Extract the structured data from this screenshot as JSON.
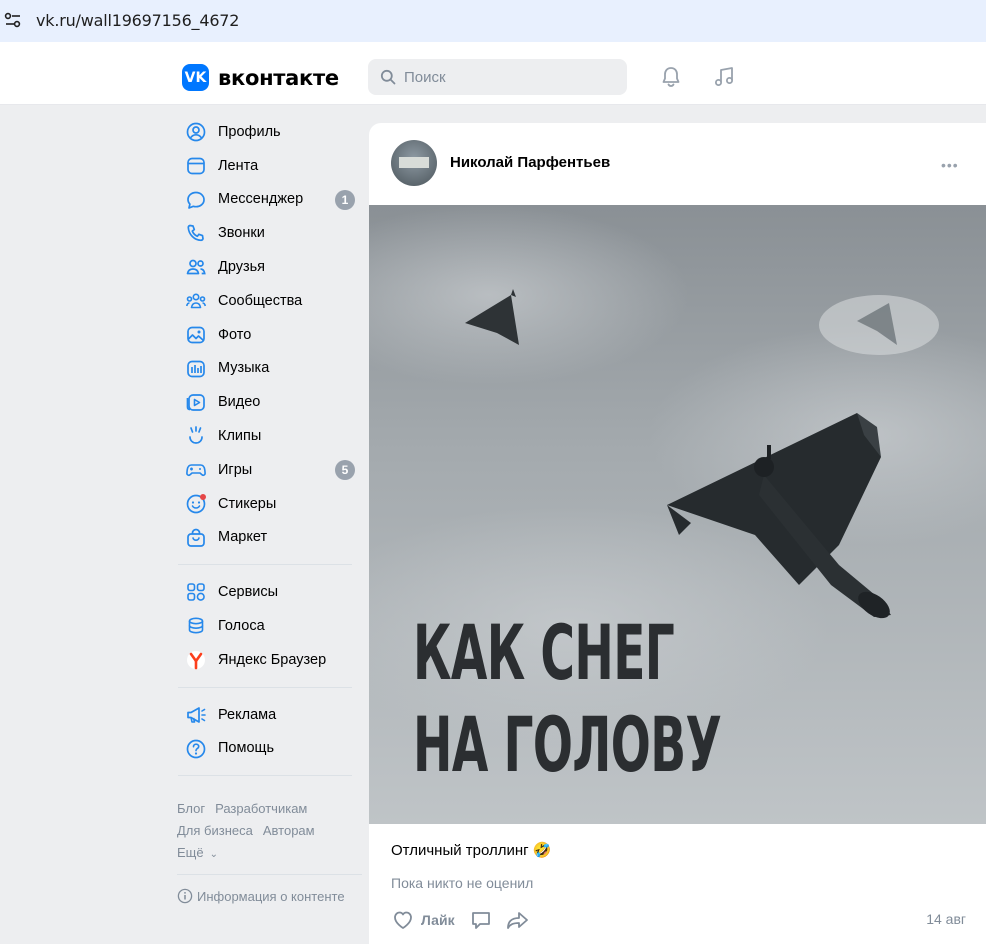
{
  "browser": {
    "url": "vk.ru/wall19697156_4672"
  },
  "header": {
    "logo_mark": "VK",
    "brand": "вконтакте",
    "search_placeholder": "Поиск"
  },
  "sidebar": {
    "items": [
      {
        "label": "Профиль",
        "icon": "profile-icon"
      },
      {
        "label": "Лента",
        "icon": "news-icon"
      },
      {
        "label": "Мессенджер",
        "icon": "messenger-icon",
        "badge": "1"
      },
      {
        "label": "Звонки",
        "icon": "phone-icon"
      },
      {
        "label": "Друзья",
        "icon": "friends-icon"
      },
      {
        "label": "Сообщества",
        "icon": "communities-icon"
      },
      {
        "label": "Фото",
        "icon": "photo-icon"
      },
      {
        "label": "Музыка",
        "icon": "music-icon"
      },
      {
        "label": "Видео",
        "icon": "video-icon"
      },
      {
        "label": "Клипы",
        "icon": "clips-icon"
      },
      {
        "label": "Игры",
        "icon": "games-icon",
        "badge": "5"
      },
      {
        "label": "Стикеры",
        "icon": "stickers-icon"
      },
      {
        "label": "Маркет",
        "icon": "market-icon"
      }
    ],
    "items2": [
      {
        "label": "Сервисы",
        "icon": "services-icon"
      },
      {
        "label": "Голоса",
        "icon": "votes-icon"
      },
      {
        "label": "Яндекс Браузер",
        "icon": "yandex-icon"
      }
    ],
    "items3": [
      {
        "label": "Реклама",
        "icon": "ads-icon"
      },
      {
        "label": "Помощь",
        "icon": "help-icon"
      }
    ],
    "footer": {
      "blog": "Блог",
      "developers": "Разработчикам",
      "business": "Для бизнеса",
      "authors": "Авторам",
      "more": "Ещё"
    },
    "info": "Информация о контенте"
  },
  "post": {
    "author": "Николай Парфентьев",
    "image_text_line1": "КАК СНЕГ",
    "image_text_line2": "НА ГОЛОВУ",
    "caption": "Отличный троллинг 🤣",
    "likes_text": "Пока никто не оценил",
    "like_label": "Лайк",
    "date": "14 авг"
  },
  "colors": {
    "accent": "#0077ff",
    "badge": "#99a2ad",
    "muted": "#818c99",
    "notify_dot": "#e64646"
  }
}
